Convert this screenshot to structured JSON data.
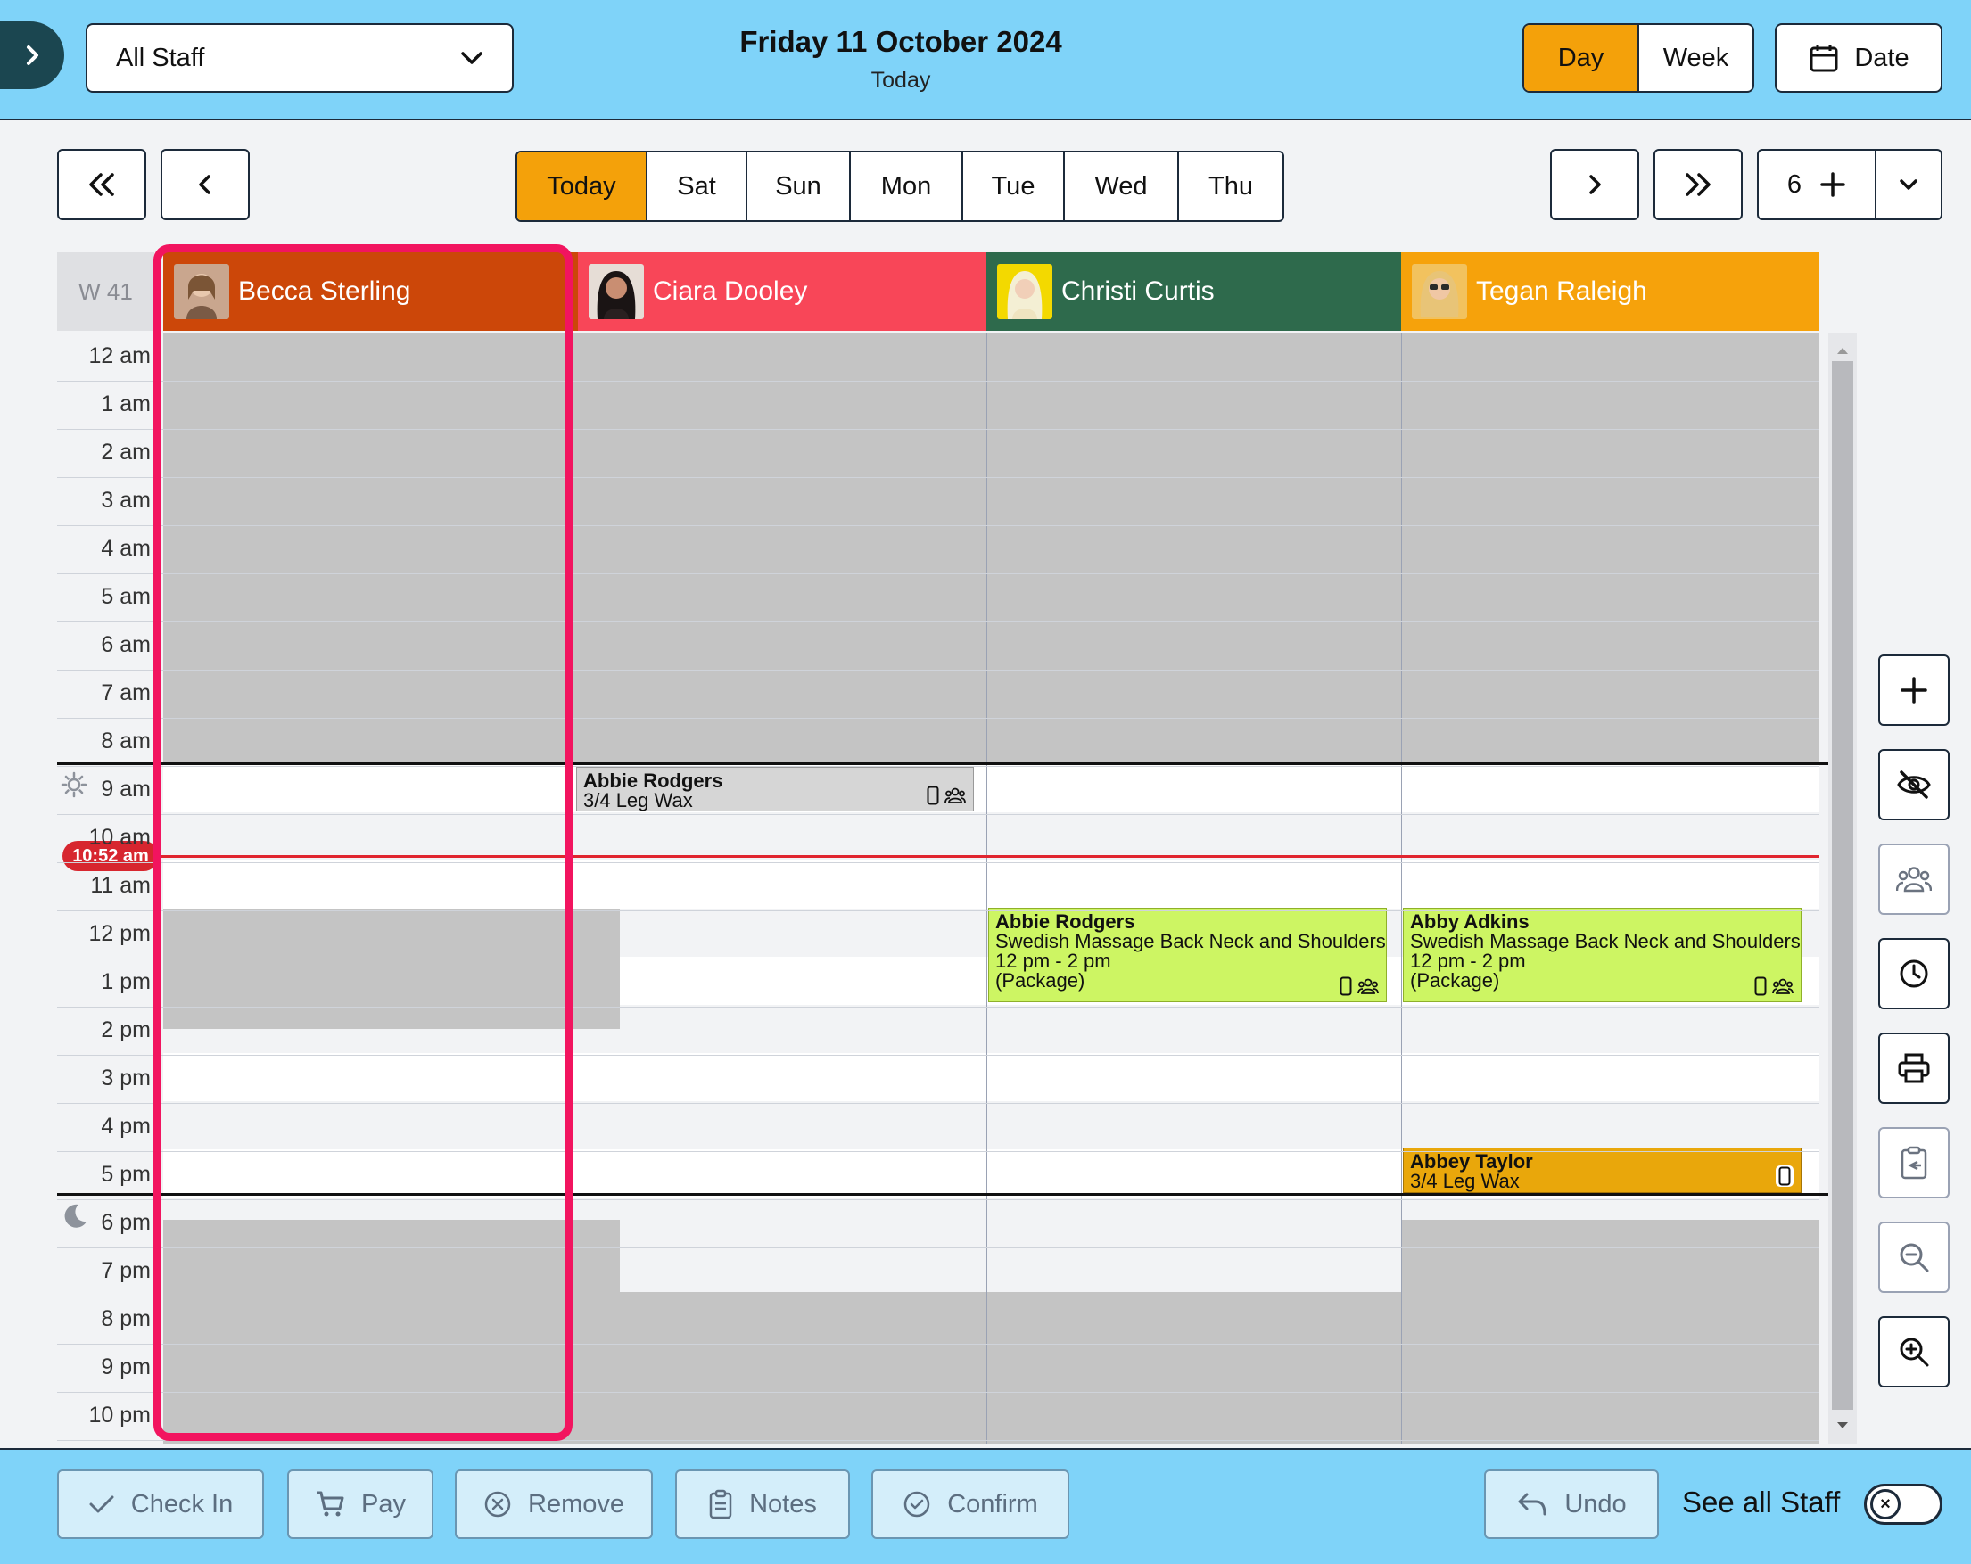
{
  "header": {
    "staff_select": "All Staff",
    "date_title": "Friday 11 October 2024",
    "date_sub": "Today",
    "view_day": "Day",
    "view_week": "Week",
    "date_button": "Date"
  },
  "nav": {
    "days": [
      "Today",
      "Sat",
      "Sun",
      "Mon",
      "Tue",
      "Wed",
      "Thu"
    ],
    "column_count": "6"
  },
  "grid": {
    "week_label": "W 41",
    "hours": [
      "12 am",
      "1 am",
      "2 am",
      "3 am",
      "4 am",
      "5 am",
      "6 am",
      "7 am",
      "8 am",
      "9 am",
      "10 am",
      "11 am",
      "12 pm",
      "1 pm",
      "2 pm",
      "3 pm",
      "4 pm",
      "5 pm",
      "6 pm",
      "7 pm",
      "8 pm",
      "9 pm",
      "10 pm"
    ],
    "current_time": "10:52 am",
    "staff": [
      {
        "name": "Becca Sterling",
        "color": "#cc4709"
      },
      {
        "name": "Ciara Dooley",
        "color": "#f84658"
      },
      {
        "name": "Christi Curtis",
        "color": "#2e6a4c"
      },
      {
        "name": "Tegan Raleigh",
        "color": "#f6a20b"
      }
    ],
    "appointments": [
      {
        "client": "Abbie Rodgers",
        "service": "3/4 Leg Wax",
        "color": "#d6d6d6"
      },
      {
        "client": "Abbie Rodgers",
        "service": "Swedish Massage Back Neck and Shoulders",
        "time": "12 pm - 2 pm",
        "note": "(Package)",
        "color": "#cdf563"
      },
      {
        "client": "Abby Adkins",
        "service": "Swedish Massage Back Neck and Shoulders",
        "time": "12 pm - 2 pm",
        "note": "(Package)",
        "color": "#cdf563"
      },
      {
        "client": "Abbey Taylor",
        "service": "3/4 Leg Wax",
        "color": "#e9a70b"
      }
    ]
  },
  "footer": {
    "check_in": "Check In",
    "pay": "Pay",
    "remove": "Remove",
    "notes": "Notes",
    "confirm": "Confirm",
    "undo": "Undo",
    "see_all_staff": "See all Staff",
    "toggle_mark": "×"
  }
}
